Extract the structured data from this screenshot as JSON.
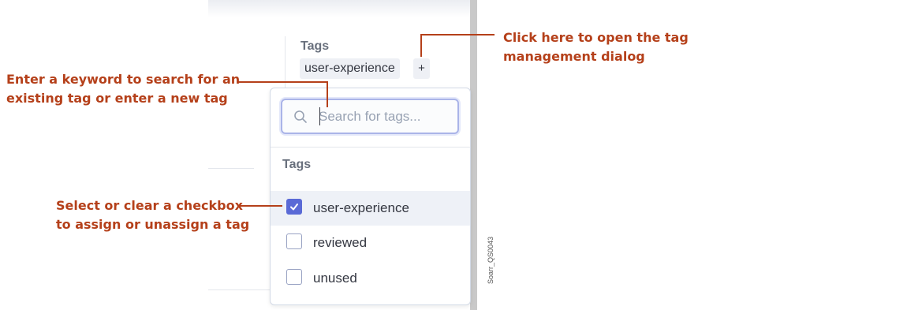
{
  "panel": {
    "tags_heading": "Tags",
    "assigned_tags": [
      "user-experience"
    ],
    "add_tag_label": "+"
  },
  "dropdown": {
    "search_placeholder": "Search for tags...",
    "group_label": "Tags",
    "options": [
      {
        "label": "user-experience",
        "checked": true
      },
      {
        "label": "reviewed",
        "checked": false
      },
      {
        "label": "unused",
        "checked": false
      }
    ]
  },
  "annotations": {
    "open_dialog": "Click here to open the tag\nmanagement dialog",
    "search": "Enter a keyword to search for an\nexisting tag or enter a new tag",
    "checkbox": "Select or clear a checkbox\nto assign or unassign a tag"
  },
  "screenshot_id": "Soarr_QS0043",
  "colors": {
    "annotation": "#b5401a",
    "checkbox_checked": "#5a6ad6",
    "focus_ring": "#aab4e8"
  },
  "icons": [
    "search-icon",
    "checkmark-icon",
    "plus-icon"
  ]
}
